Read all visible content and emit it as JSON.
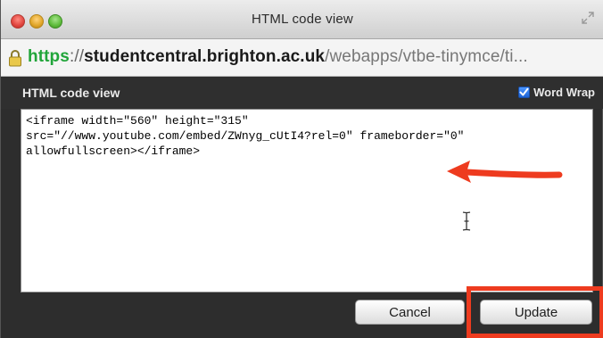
{
  "window": {
    "title": "HTML code view"
  },
  "address_bar": {
    "scheme": "https",
    "separator": "://",
    "host": "studentcentral.brighton.ac.uk",
    "path": "/webapps/vtbe-tinymce/ti..."
  },
  "panel": {
    "title": "HTML code view",
    "word_wrap_label": "Word Wrap",
    "word_wrap_checked": true
  },
  "editor": {
    "content": "<iframe width=\"560\" height=\"315\"\nsrc=\"//www.youtube.com/embed/ZWnyg_cUtI4?rel=0\" frameborder=\"0\"\nallowfullscreen></iframe>"
  },
  "buttons": {
    "cancel_label": "Cancel",
    "update_label": "Update"
  },
  "annotations": {
    "arrow_color": "#ee3b1f",
    "highlight_color": "#ee3b1f",
    "highlighted_target": "update-button"
  },
  "icons": {
    "lock": "lock-icon",
    "fullscreen": "fullscreen-icon",
    "checkbox": "checkmark-icon"
  }
}
